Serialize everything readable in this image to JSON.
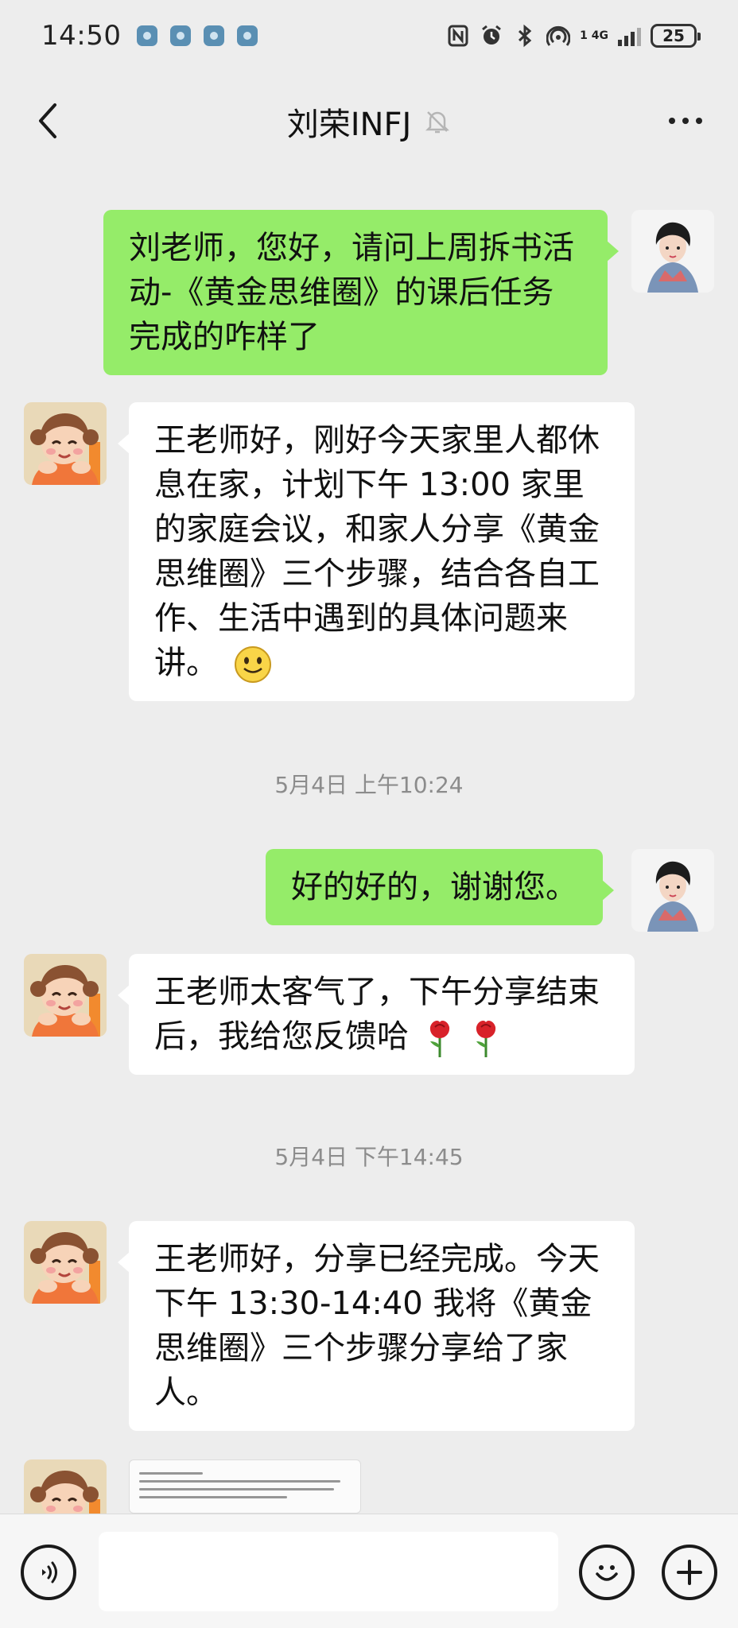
{
  "status_bar": {
    "time": "14:50",
    "network_label": "4G",
    "signal_label": "1",
    "battery": "25"
  },
  "header": {
    "title": "刘荣INFJ"
  },
  "messages": [
    {
      "sender": "me",
      "text": "刘老师，您好，请问上周拆书活动-《黄金思维圈》的课后任务完成的咋样了"
    },
    {
      "sender": "them",
      "text": "王老师好，刚好今天家里人都休息在家，计划下午 13:00 家里的家庭会议，和家人分享《黄金思维圈》三个步骤，结合各自工作、生活中遇到的具体问题来讲。",
      "emoji": "slightly-smiling-face-icon"
    },
    {
      "timestamp": "5月4日 上午10:24"
    },
    {
      "sender": "me",
      "text": "好的好的，谢谢您。"
    },
    {
      "sender": "them",
      "text": "王老师太客气了，下午分享结束后，我给您反馈哈",
      "emoji": "rose-icon"
    },
    {
      "timestamp": "5月4日 下午14:45"
    },
    {
      "sender": "them",
      "text": "王老师好，分享已经完成。今天下午 13:30-14:40 我将《黄金思维圈》三个步骤分享给了家人。"
    },
    {
      "sender": "them",
      "type": "image"
    }
  ],
  "colors": {
    "background": "#ededed",
    "my_bubble": "#95ec69",
    "their_bubble": "#ffffff",
    "timestamp_text": "#8c8c8c"
  },
  "input": {
    "value": "",
    "placeholder": ""
  }
}
